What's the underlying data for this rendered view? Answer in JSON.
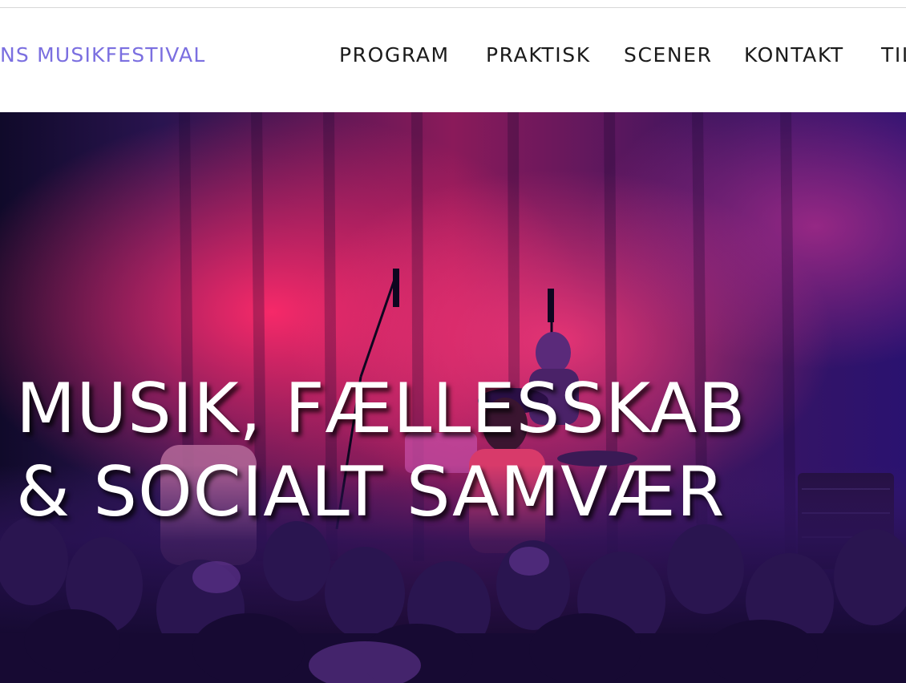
{
  "header": {
    "site_title": "NS MUSIKFESTIVAL",
    "nav": [
      {
        "label": "PROGRAM"
      },
      {
        "label": "PRAKTISK"
      },
      {
        "label": "SCENER"
      },
      {
        "label": "KONTAKT"
      },
      {
        "label": "TIL"
      }
    ]
  },
  "hero": {
    "headline_line1": "MUSIK, FÆLLESSKAB",
    "headline_line2": "& SOCIALT SAMVÆR",
    "image_subject": "band performing on stage in front of crowd"
  },
  "colors": {
    "site_title": "#7b6fe0",
    "nav_text": "#1b1b1b",
    "hero_text": "#ffffff"
  }
}
